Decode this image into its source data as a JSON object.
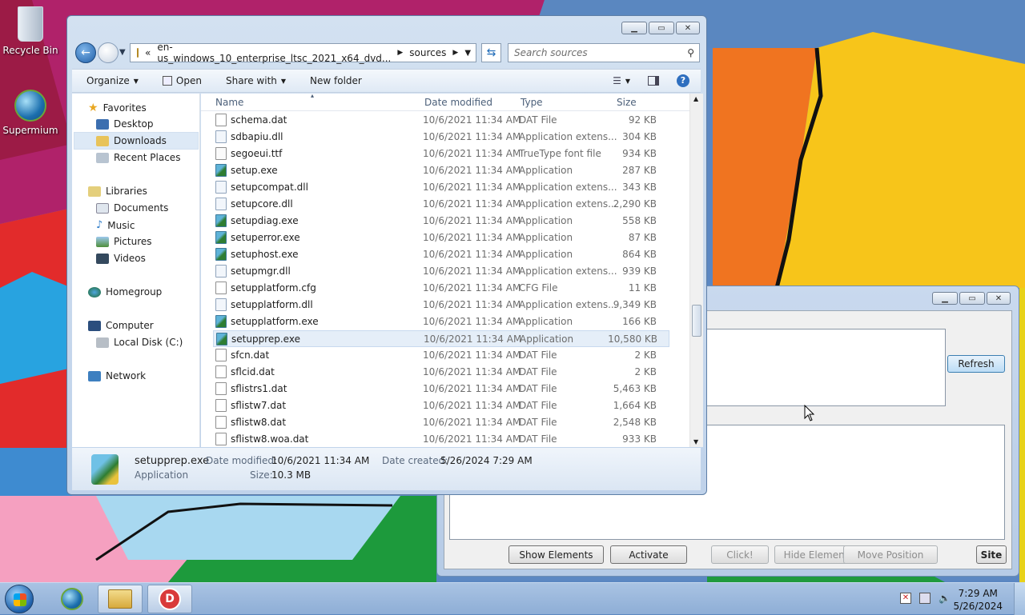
{
  "desktop": {
    "icons": [
      {
        "label": "Recycle Bin"
      },
      {
        "label": "Supermium"
      }
    ]
  },
  "explorer": {
    "address": {
      "prefix": "«",
      "path_segment1": "en-us_windows_10_enterprise_ltsc_2021_x64_dvd...",
      "path_segment2": "sources"
    },
    "search_placeholder": "Search sources",
    "toolbar": {
      "organize": "Organize",
      "open": "Open",
      "share_with": "Share with",
      "new_folder": "New folder"
    },
    "nav": {
      "favorites": "Favorites",
      "desktop": "Desktop",
      "downloads": "Downloads",
      "recent": "Recent Places",
      "libraries": "Libraries",
      "documents": "Documents",
      "music": "Music",
      "pictures": "Pictures",
      "videos": "Videos",
      "homegroup": "Homegroup",
      "computer": "Computer",
      "local_disk": "Local Disk (C:)",
      "network": "Network"
    },
    "columns": {
      "name": "Name",
      "date": "Date modified",
      "type": "Type",
      "size": "Size"
    },
    "files": [
      {
        "name": "schema.dat",
        "date": "10/6/2021 11:34 AM",
        "type": "DAT File",
        "size": "92 KB",
        "kind": "dat"
      },
      {
        "name": "sdbapiu.dll",
        "date": "10/6/2021 11:34 AM",
        "type": "Application extens...",
        "size": "304 KB",
        "kind": "dll"
      },
      {
        "name": "segoeui.ttf",
        "date": "10/6/2021 11:34 AM",
        "type": "TrueType font file",
        "size": "934 KB",
        "kind": "ttf"
      },
      {
        "name": "setup.exe",
        "date": "10/6/2021 11:34 AM",
        "type": "Application",
        "size": "287 KB",
        "kind": "exe"
      },
      {
        "name": "setupcompat.dll",
        "date": "10/6/2021 11:34 AM",
        "type": "Application extens...",
        "size": "343 KB",
        "kind": "dll"
      },
      {
        "name": "setupcore.dll",
        "date": "10/6/2021 11:34 AM",
        "type": "Application extens...",
        "size": "2,290 KB",
        "kind": "dll"
      },
      {
        "name": "setupdiag.exe",
        "date": "10/6/2021 11:34 AM",
        "type": "Application",
        "size": "558 KB",
        "kind": "exe"
      },
      {
        "name": "setuperror.exe",
        "date": "10/6/2021 11:34 AM",
        "type": "Application",
        "size": "87 KB",
        "kind": "exe"
      },
      {
        "name": "setuphost.exe",
        "date": "10/6/2021 11:34 AM",
        "type": "Application",
        "size": "864 KB",
        "kind": "exe"
      },
      {
        "name": "setupmgr.dll",
        "date": "10/6/2021 11:34 AM",
        "type": "Application extens...",
        "size": "939 KB",
        "kind": "dll"
      },
      {
        "name": "setupplatform.cfg",
        "date": "10/6/2021 11:34 AM",
        "type": "CFG File",
        "size": "11 KB",
        "kind": "dat"
      },
      {
        "name": "setupplatform.dll",
        "date": "10/6/2021 11:34 AM",
        "type": "Application extens...",
        "size": "9,349 KB",
        "kind": "dll"
      },
      {
        "name": "setupplatform.exe",
        "date": "10/6/2021 11:34 AM",
        "type": "Application",
        "size": "166 KB",
        "kind": "exe"
      },
      {
        "name": "setupprep.exe",
        "date": "10/6/2021 11:34 AM",
        "type": "Application",
        "size": "10,580 KB",
        "kind": "exe",
        "selected": true
      },
      {
        "name": "sfcn.dat",
        "date": "10/6/2021 11:34 AM",
        "type": "DAT File",
        "size": "2 KB",
        "kind": "dat"
      },
      {
        "name": "sflcid.dat",
        "date": "10/6/2021 11:34 AM",
        "type": "DAT File",
        "size": "2 KB",
        "kind": "dat"
      },
      {
        "name": "sflistrs1.dat",
        "date": "10/6/2021 11:34 AM",
        "type": "DAT File",
        "size": "5,463 KB",
        "kind": "dat"
      },
      {
        "name": "sflistw7.dat",
        "date": "10/6/2021 11:34 AM",
        "type": "DAT File",
        "size": "1,664 KB",
        "kind": "dat"
      },
      {
        "name": "sflistw8.dat",
        "date": "10/6/2021 11:34 AM",
        "type": "DAT File",
        "size": "2,548 KB",
        "kind": "dat"
      },
      {
        "name": "sflistw8.woa.dat",
        "date": "10/6/2021 11:34 AM",
        "type": "DAT File",
        "size": "933 KB",
        "kind": "dat"
      }
    ],
    "details": {
      "filename": "setupprep.exe",
      "filetype": "Application",
      "date_modified_label": "Date modified:",
      "date_modified": "10/6/2021 11:34 AM",
      "date_created_label": "Date created:",
      "date_created": "5/26/2024 7:29 AM",
      "size_label": "Size:",
      "size": "10.3 MB"
    }
  },
  "app2": {
    "refresh": "Refresh",
    "buttons": {
      "show_elements": "Show Elements",
      "activate": "Activate",
      "click": "Click!",
      "hide_element": "Hide Element",
      "move_position": "Move Position",
      "site": "Site"
    }
  },
  "taskbar": {
    "time": "7:29 AM",
    "date": "5/26/2024"
  }
}
